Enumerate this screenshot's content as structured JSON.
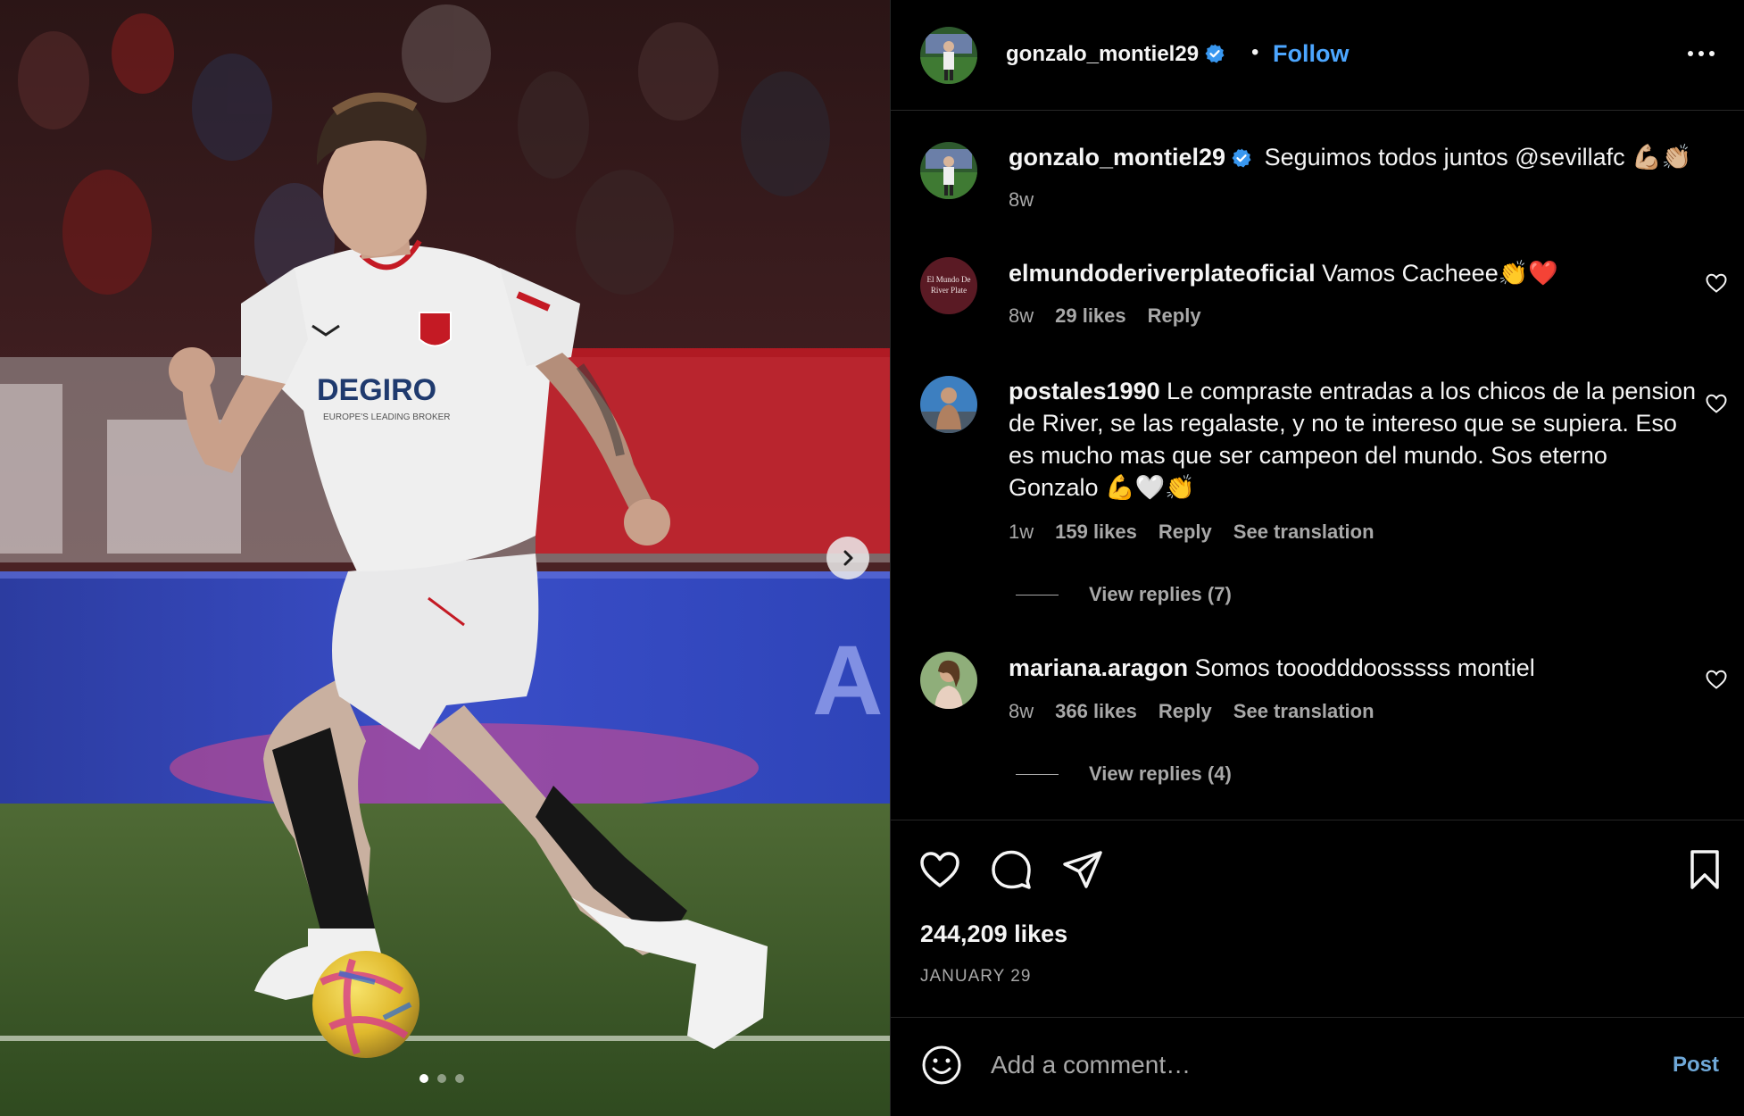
{
  "post": {
    "username": "gonzalo_montiel29",
    "follow_label": "Follow",
    "separator": "•",
    "caption_user": "gonzalo_montiel29",
    "caption_text": "Seguimos todos juntos @sevillafc 💪🏼👏🏼",
    "caption_age": "8w",
    "likes": "244,209 likes",
    "date": "JANUARY 29",
    "carousel": {
      "slides": 3,
      "active_index": 0
    }
  },
  "media": {
    "shirt_sponsor": "DEGIRO",
    "shirt_tagline": "EUROPE'S LEADING BROKER"
  },
  "comments": [
    {
      "user": "elmundoderiverplateoficial",
      "avatar_text": [
        "El Mundo De",
        "River Plate"
      ],
      "text": "Vamos Cacheee👏❤️",
      "age": "8w",
      "likes": "29 likes",
      "reply_label": "Reply"
    },
    {
      "user": "postales1990",
      "text": "Le compraste entradas a los chicos de la pension de River, se las regalaste, y no te intereso que se supiera. Eso es mucho mas que ser campeon del mundo. Sos eterno Gonzalo 💪🤍👏",
      "age": "1w",
      "likes": "159 likes",
      "reply_label": "Reply",
      "translate_label": "See translation",
      "view_replies": "View replies (7)"
    },
    {
      "user": "mariana.aragon",
      "text": "Somos tooodddoosssss montiel",
      "age": "8w",
      "likes": "366 likes",
      "reply_label": "Reply",
      "translate_label": "See translation",
      "view_replies": "View replies (4)"
    }
  ],
  "composer": {
    "placeholder": "Add a comment…",
    "post_label": "Post"
  },
  "icons": [
    "more-icon",
    "verified-icon",
    "heart-icon",
    "comment-icon",
    "share-icon",
    "bookmark-icon",
    "emoji-icon",
    "chevron-right-icon"
  ],
  "colors": {
    "accent": "#4ca6ff",
    "background": "#000000",
    "muted": "#a8a8a8",
    "verified": "#3897f0"
  }
}
